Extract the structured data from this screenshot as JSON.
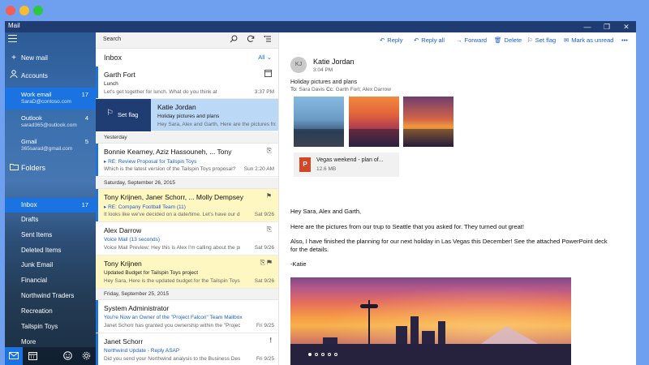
{
  "window": {
    "title": "Mail",
    "controls": [
      "—",
      "❐",
      "✕"
    ]
  },
  "sidebar": {
    "new_mail": "New mail",
    "accounts_label": "Accounts",
    "accounts": [
      {
        "name": "Work email",
        "email": "SaraD@contoso.com",
        "count": "17"
      },
      {
        "name": "Outlook",
        "email": "sarad365@outlook.com",
        "count": "4"
      },
      {
        "name": "Gmail",
        "email": "365sarad@gmail.com",
        "count": "5"
      }
    ],
    "folders_label": "Folders",
    "folders": [
      {
        "label": "Inbox",
        "count": "17"
      },
      {
        "label": "Drafts"
      },
      {
        "label": "Sent Items"
      },
      {
        "label": "Deleted Items"
      },
      {
        "label": "Junk Email"
      },
      {
        "label": "Financial"
      },
      {
        "label": "Northwind Traders"
      },
      {
        "label": "Recreation"
      },
      {
        "label": "Tailspin Toys"
      },
      {
        "label": "More"
      }
    ]
  },
  "list": {
    "search_placeholder": "Search",
    "header": "Inbox",
    "filter": "All",
    "flag_label": "Set flag",
    "separators": {
      "yesterday": "Yesterday",
      "saturday": "Saturday, September 26, 2015",
      "friday": "Friday, September 25, 2015"
    },
    "messages": [
      {
        "from": "Garth Fort",
        "subject": "Lunch",
        "preview": "Let's get together for lunch. What do you think at",
        "time": "3:37 PM"
      },
      {
        "from": "Katie Jordan",
        "subject": "Holiday pictures and plans",
        "preview": "Hey Sara, Alex and Garth, Here are the pictures from"
      },
      {
        "from": "Bonnie Kearney, Aziz Hassouneh, ... Tony",
        "subject": "RE: Review Proposal for Tailspin Toys",
        "preview": "Which is the latest version of the Tailspin Toys proposal?",
        "time": "Sun 2:20 AM"
      },
      {
        "from": "Tony Krijnen, Janer Schorr, ... Molly Dempsey",
        "subject": "RE: Company Football Team  (11)",
        "preview": "It looks like we've decided on a date/time. Let's have our din",
        "time": "Sat 9/26"
      },
      {
        "from": "Alex Darrow",
        "subject": "Voice Mail (13 seconds)",
        "preview": "Voice Mail Preview: Hey this is Alex I'm calling about the pro",
        "time": "Sat 9/26"
      },
      {
        "from": "Tony Krijnen",
        "subject": "Updated Budget for Tailspin Toys project",
        "preview": "Hey Sara, Here is the updated budget for the Tailspin Toys p",
        "time": "Sat 9/26"
      },
      {
        "from": "System Administrator",
        "subject": "You're Now an Owner of the \"Project Falcon\" Team Mailbox",
        "preview": "Janet Schorr has granted you ownership within the \"Project F",
        "time": "Fri 9/25"
      },
      {
        "from": "Janet Schorr",
        "subject": "Northwind Update - Reply ASAP",
        "preview": "Did you send your Northwind analysis to the Business Desk?",
        "time": "Fri 9/25"
      }
    ]
  },
  "reading": {
    "commands": [
      "Reply",
      "Reply all",
      "Forward",
      "Delete",
      "Set flag",
      "Mark as unread",
      "•••"
    ],
    "avatar_initials": "KJ",
    "sender": "Katie Jordan",
    "date": "3:04 PM",
    "subject": "Holiday pictures and plans",
    "to_label": "To:",
    "to": "Sara Davis",
    "cc_label": "Cc:",
    "cc": "Garth Fort; Alex Darrow",
    "attachment_name": "Vegas weekend - plan of...",
    "attachment_size": "12.6 MB",
    "body": [
      "Hey Sara, Alex and Garth,",
      "Here are the pictures from our trup to Seattle that you asked for. They turned out great!",
      "Also, I have finished the planning for our next holiday in Las Vegas this December! See the attached PowerPoint deck for the details.",
      "-Katie"
    ]
  }
}
